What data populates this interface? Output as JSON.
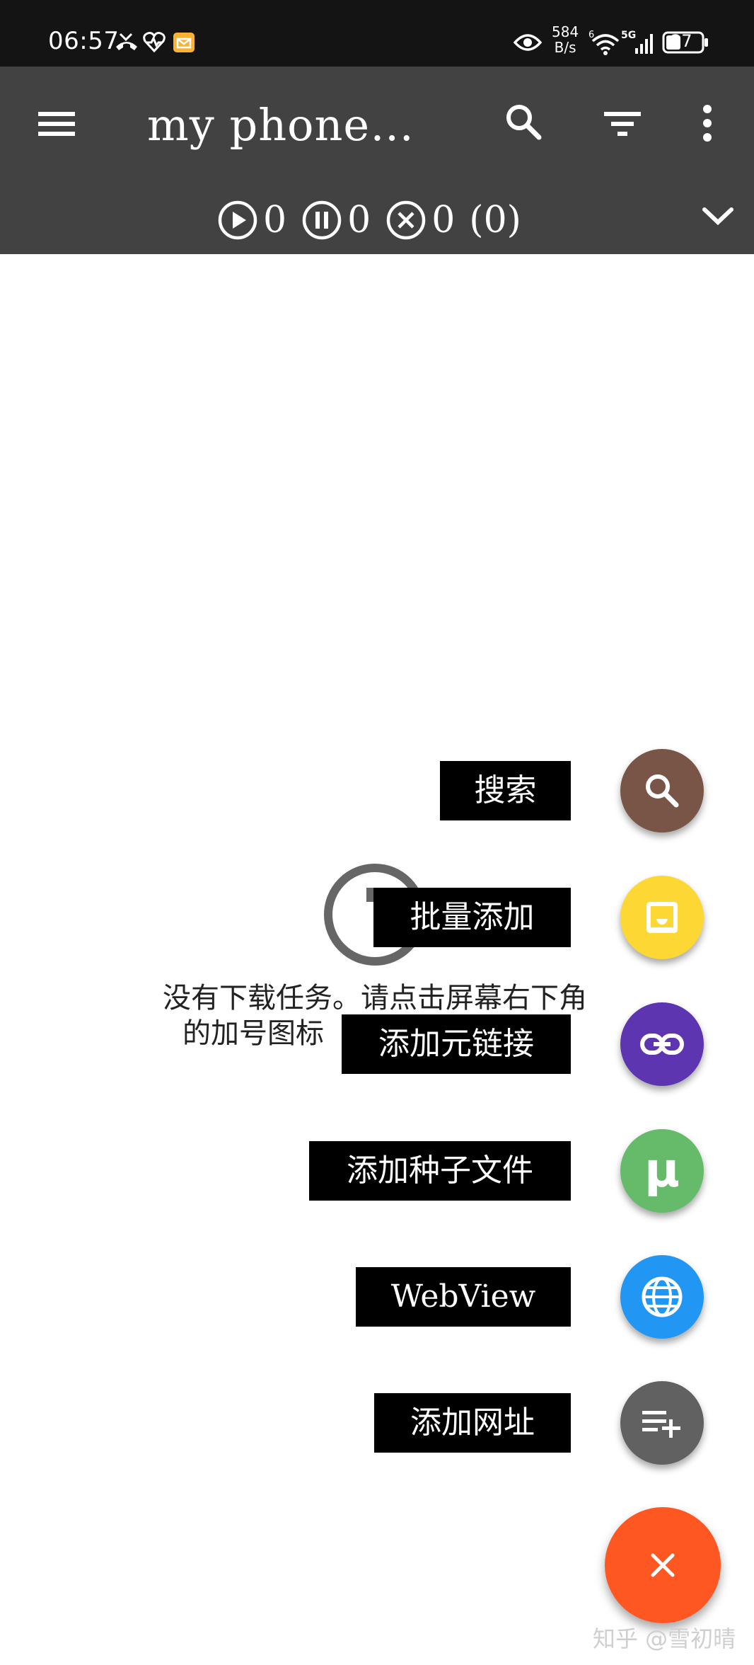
{
  "status_bar": {
    "time": "06:57",
    "net_speed_value": "584",
    "net_speed_unit": "B/s",
    "battery": "37",
    "icons": [
      "missed-call-icon",
      "health-icon",
      "mail-icon",
      "eye-icon",
      "wifi-icon",
      "signal-5g-icon",
      "battery-icon"
    ]
  },
  "toolbar": {
    "title": "my phone…",
    "icons": [
      "menu-icon",
      "search-icon",
      "filter-icon",
      "more-vert-icon",
      "chevron-down-icon"
    ]
  },
  "counters": {
    "running": "0",
    "paused": "0",
    "stopped": "0",
    "total": "(0)"
  },
  "empty_state": {
    "line1": "没有下载任务。请点击屏幕右下角",
    "line2": "的加号图标"
  },
  "fab_menu": {
    "items": [
      {
        "label": "搜索",
        "icon": "search-icon",
        "color": "#795548"
      },
      {
        "label": "批量添加",
        "icon": "inbox-tray-icon",
        "color": "#FDD835"
      },
      {
        "label": "添加元链接",
        "icon": "link-icon",
        "color": "#5E35B1"
      },
      {
        "label": "添加种子文件",
        "icon": "utorrent-icon",
        "color": "#66BB6A"
      },
      {
        "label": "WebView",
        "icon": "globe-icon",
        "color": "#2196F3"
      },
      {
        "label": "添加网址",
        "icon": "playlist-add-icon",
        "color": "#616161"
      }
    ],
    "main_icon": "close-icon",
    "main_color": "#FF5722"
  },
  "watermark": "知乎 @雪初晴"
}
